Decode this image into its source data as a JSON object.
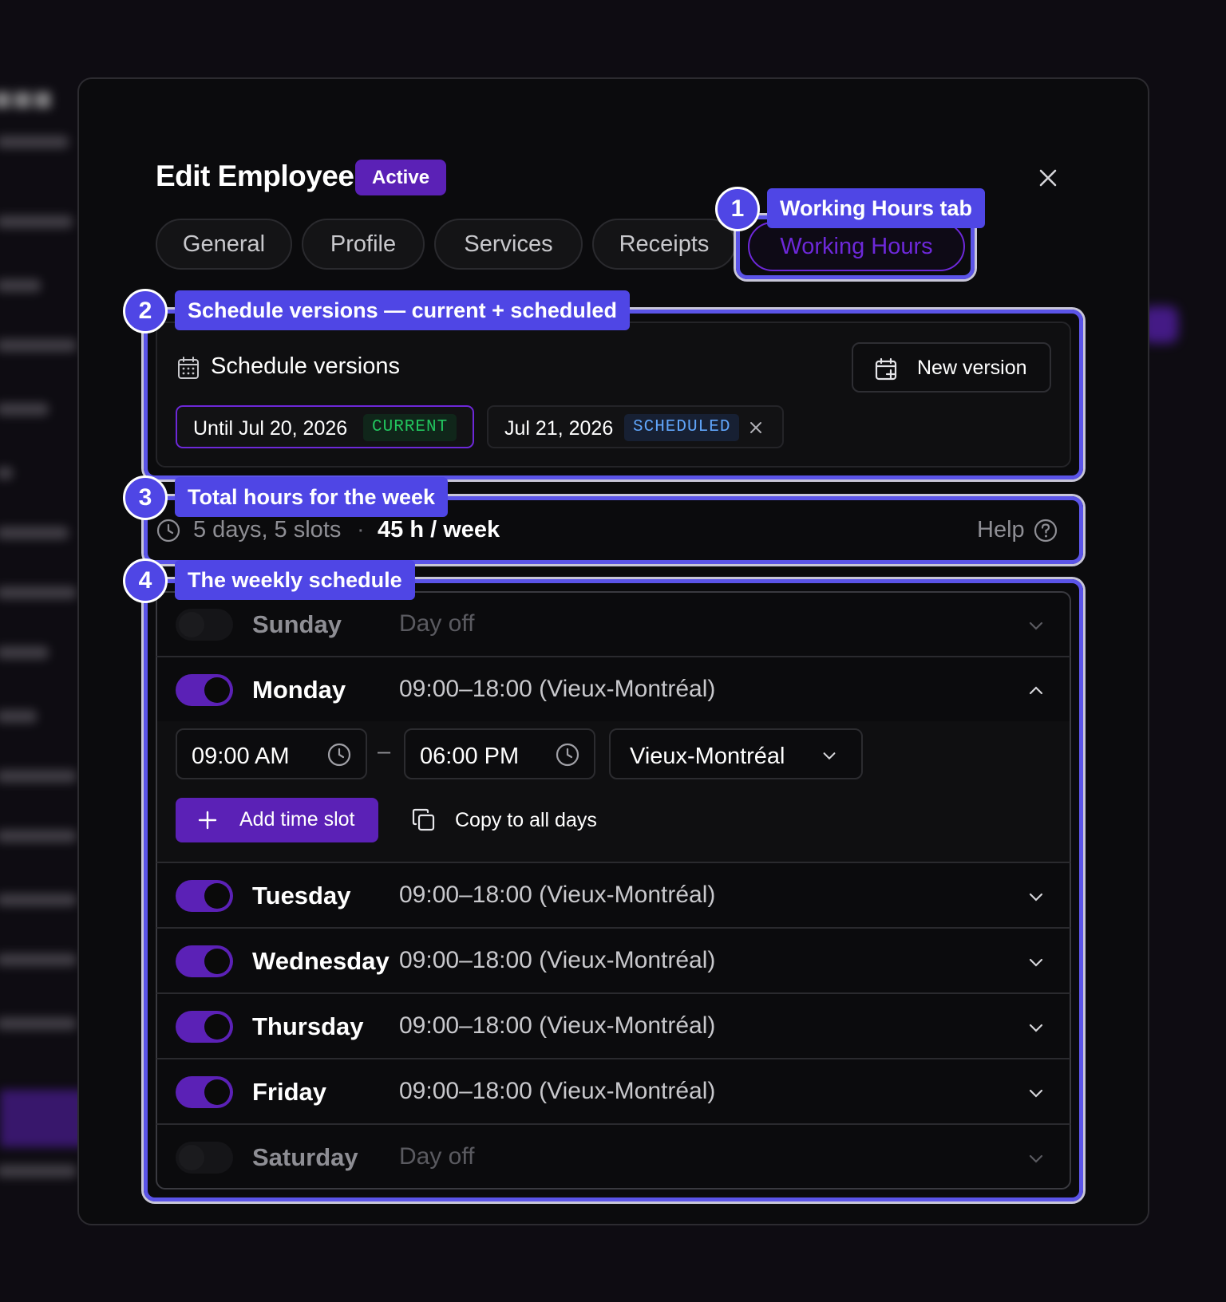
{
  "modal": {
    "title": "Edit Employee",
    "status_badge": "Active"
  },
  "tabs": [
    {
      "label": "General"
    },
    {
      "label": "Profile"
    },
    {
      "label": "Services"
    },
    {
      "label": "Receipts"
    },
    {
      "label": "Working Hours",
      "selected": true
    }
  ],
  "callouts": [
    {
      "number": "1",
      "label": "Working Hours tab"
    },
    {
      "number": "2",
      "label": "Schedule versions — current + scheduled"
    },
    {
      "number": "3",
      "label": "Total hours for the week"
    },
    {
      "number": "4",
      "label": "The weekly schedule"
    }
  ],
  "schedule_versions": {
    "title": "Schedule versions",
    "new_version_label": "New version",
    "versions": [
      {
        "label": "Until Jul 20, 2026",
        "tag": "CURRENT"
      },
      {
        "label": "Jul 21, 2026",
        "tag": "SCHEDULED"
      }
    ]
  },
  "summary": {
    "days_slots": "5 days, 5 slots",
    "separator": "·",
    "total": "45 h / week",
    "help_label": "Help"
  },
  "days": [
    {
      "name": "Sunday",
      "hours": "Day off",
      "enabled": false
    },
    {
      "name": "Monday",
      "hours": "09:00–18:00 (Vieux-Montréal)",
      "enabled": true,
      "expanded": true
    },
    {
      "name": "Tuesday",
      "hours": "09:00–18:00 (Vieux-Montréal)",
      "enabled": true
    },
    {
      "name": "Wednesday",
      "hours": "09:00–18:00 (Vieux-Montréal)",
      "enabled": true
    },
    {
      "name": "Thursday",
      "hours": "09:00–18:00 (Vieux-Montréal)",
      "enabled": true
    },
    {
      "name": "Friday",
      "hours": "09:00–18:00 (Vieux-Montréal)",
      "enabled": true
    },
    {
      "name": "Saturday",
      "hours": "Day off",
      "enabled": false
    }
  ],
  "monday_editor": {
    "start_time": "09:00 AM",
    "dash": "–",
    "end_time": "06:00 PM",
    "location": "Vieux-Montréal",
    "add_slot_label": "Add time slot",
    "copy_label": "Copy to all days"
  },
  "colors": {
    "accent": "#5b21b6",
    "callout": "#4f46e5",
    "current_tag": "#22c55e",
    "scheduled_tag": "#60a5fa"
  }
}
